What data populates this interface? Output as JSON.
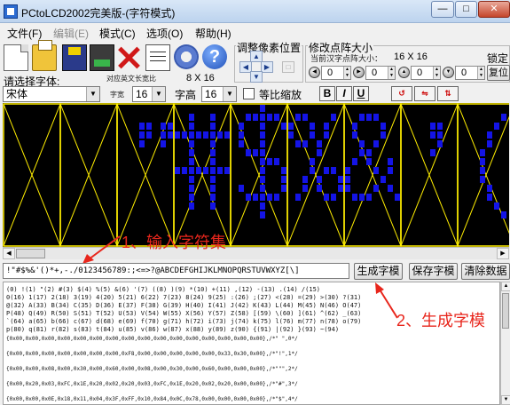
{
  "window": {
    "title": "PCtoLCD2002完美版-(字符模式)"
  },
  "menu": [
    {
      "label": "文件(F)",
      "enabled": true
    },
    {
      "label": "编辑(E)",
      "enabled": false
    },
    {
      "label": "模式(C)",
      "enabled": true
    },
    {
      "label": "选项(O)",
      "enabled": true
    },
    {
      "label": "帮助(H)",
      "enabled": true
    }
  ],
  "toolbar_icons": [
    "new-icon",
    "open-icon",
    "save-icon",
    "save-as-icon",
    "delete-icon",
    "notes-icon",
    "settings-icon",
    "help-icon"
  ],
  "pixel_adjust": {
    "label": "调整像素位置"
  },
  "dot_size": {
    "label": "修改点阵大小",
    "current_label": "当前汉字点阵大小：",
    "current_value": "16 X 16",
    "values": [
      "0",
      "0",
      "0",
      "0"
    ],
    "lock_label": "锁定",
    "reset_label": "复位"
  },
  "font": {
    "label": "请选择字体:",
    "selected": "宋体",
    "en_width_label": "对应英文长宽比",
    "en_width_value": "8 X 16",
    "width_label": "字宽",
    "width_value": "16",
    "height_label": "字高",
    "height_value": "16",
    "monospace_label": "等比缩放",
    "bold": "B",
    "italic": "I",
    "underline": "U"
  },
  "annotations": {
    "step1": "1、输入字符集",
    "step2": "2、生成字模"
  },
  "charset_input": {
    "value": "!\"#$%&'()*+,-./0123456789:;<=>?@ABCDEFGHIJKLMNOPQRSTUVWXYZ[\\]"
  },
  "buttons": {
    "generate": "生成字模",
    "save": "保存字模",
    "clear": "清除数据"
  },
  "preview_glyphs": [
    " ",
    "!",
    "\"",
    "#",
    "$",
    "%",
    "&",
    "'",
    "("
  ],
  "output": {
    "glyph_rows": [
      "(0) !(1) \"(2) #(3) $(4) %(5) &(6) '(7) ((8) )(9) *(10) +(11) ,(12) -(13) .(14) /(15)",
      "0(16) 1(17) 2(18) 3(19) 4(20) 5(21) 6(22) 7(23) 8(24) 9(25) :(26) ;(27) <(28) =(29) >(30) ?(31)",
      "@(32) A(33) B(34) C(35) D(36) E(37) F(38) G(39) H(40) I(41) J(42) K(43) L(44) M(45) N(46) O(47)",
      "P(48) Q(49) R(50) S(51) T(52) U(53) V(54) W(55) X(56) Y(57) Z(58) [(59) \\(60) ](61) ^(62) _(63)",
      "`(64) a(65) b(66) c(67) d(68) e(69) f(70) g(71) h(72) i(73) j(74) k(75) l(76) m(77) n(78) o(79)",
      "p(80) q(81) r(82) s(83) t(84) u(85) v(86) w(87) x(88) y(89) z(90) {(91) |(92) }(93) ~(94)"
    ],
    "data_rows": [
      "{0x00,0x00,0x00,0x00,0x00,0x00,0x00,0x00,0x00,0x00,0x00,0x00,0x00,0x00,0x00,0x00},/*\" \",0*/",
      "{0x00,0x00,0x00,0x00,0x00,0x00,0x00,0xF8,0x00,0x00,0x00,0x00,0x00,0x33,0x30,0x00},/*\"!\",1*/",
      "{0x00,0x00,0x08,0x00,0x30,0x00,0x60,0x00,0x08,0x00,0x30,0x00,0x60,0x00,0x00,0x00},/*\"\"\",2*/",
      "{0x00,0x20,0x03,0xFC,0x1E,0x20,0x02,0x20,0x03,0xFC,0x1E,0x20,0x02,0x20,0x00,0x00},/*\"#\",3*/",
      "{0x00,0x00,0x0E,0x18,0x11,0x04,0x3F,0xFF,0x10,0x84,0x0C,0x78,0x00,0x00,0x00,0x00},/*\"$\",4*/"
    ]
  }
}
